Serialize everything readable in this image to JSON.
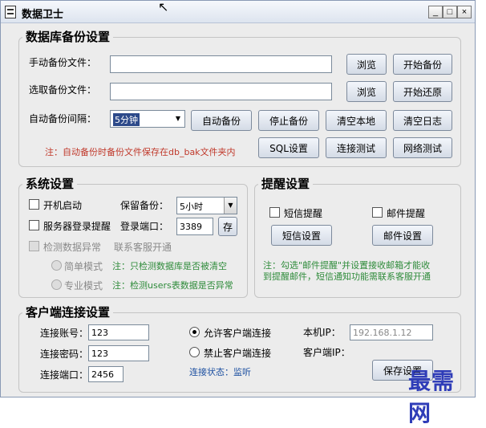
{
  "window": {
    "title": "数据卫士",
    "min": "_",
    "max": "□",
    "close": "×"
  },
  "backup": {
    "title": "数据库备份设置",
    "manual_label": "手动备份文件：",
    "manual_value": "",
    "select_label": "选取备份文件：",
    "select_value": "",
    "browse1": "浏览",
    "start_backup": "开始备份",
    "browse2": "浏览",
    "start_restore": "开始还原",
    "interval_label": "自动备份间隔：",
    "interval_value": "5分钟",
    "auto_backup": "自动备份",
    "stop_backup": "停止备份",
    "clear_local": "清空本地",
    "clear_log": "清空日志",
    "note": "注：自动备份时备份文件保存在db_bak文件夹内",
    "sql_settings": "SQL设置",
    "conn_test": "连接测试",
    "net_test": "网络测试"
  },
  "system": {
    "title": "系统设置",
    "autostart": "开机启动",
    "keep_label": "保留备份：",
    "keep_value": "5小时",
    "server_login_alert": "服务器登录提醒",
    "login_port_label": "登录端口：",
    "login_port_value": "3389",
    "save": "存",
    "detect_label": "检测数据异常",
    "contact_label": "联系客服开通",
    "simple_mode": "简单模式",
    "simple_note": "注：只检测数据库是否被清空",
    "pro_mode": "专业模式",
    "pro_note": "注：检测users表数据是否异常"
  },
  "alert": {
    "title": "提醒设置",
    "sms_label": "短信提醒",
    "mail_label": "邮件提醒",
    "sms_settings": "短信设置",
    "mail_settings": "邮件设置",
    "note_line1": "注：勾选\"邮件提醒\"并设置接收邮箱才能收",
    "note_line2": "到提醒邮件，短信通知功能需联系客服开通"
  },
  "client": {
    "title": "客户端连接设置",
    "account_label": "连接账号：",
    "account_value": "123",
    "password_label": "连接密码：",
    "password_value": "123",
    "port_label": "连接端口：",
    "port_value": "2456",
    "allow_label": "允许客户端连接",
    "deny_label": "禁止客户端连接",
    "status_label": "连接状态：监听",
    "local_ip_label": "本机IP：",
    "local_ip_value": "192.168.1.12",
    "client_ip_label": "客户端IP：",
    "save_button": "保存设置"
  },
  "watermark": "最需网"
}
